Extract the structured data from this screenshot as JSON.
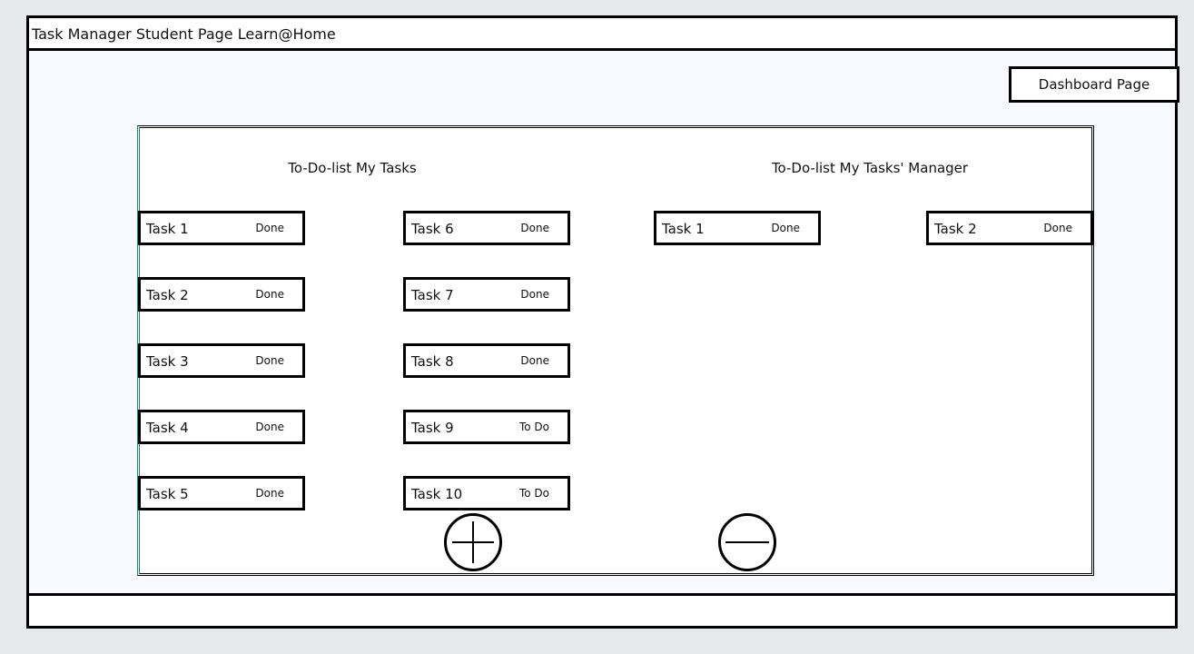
{
  "header": {
    "title": "Task Manager Student Page Learn@Home"
  },
  "dashboard_button": "Dashboard Page",
  "my_tasks": {
    "heading": "To-Do-list My Tasks",
    "tasks": [
      {
        "name": "Task 1",
        "status": "Done"
      },
      {
        "name": "Task 2",
        "status": "Done"
      },
      {
        "name": "Task 3",
        "status": "Done"
      },
      {
        "name": "Task 4",
        "status": "Done"
      },
      {
        "name": "Task 5",
        "status": "Done"
      },
      {
        "name": "Task 6",
        "status": "Done"
      },
      {
        "name": "Task 7",
        "status": "Done"
      },
      {
        "name": "Task 8",
        "status": "Done"
      },
      {
        "name": "Task 9",
        "status": "To Do"
      },
      {
        "name": "Task 10",
        "status": "To Do"
      }
    ]
  },
  "manager_tasks": {
    "heading": "To-Do-list My Tasks' Manager",
    "tasks": [
      {
        "name": "Task 1",
        "status": "Done"
      },
      {
        "name": "Task 2",
        "status": "Done"
      }
    ]
  },
  "actions": {
    "add_icon": "plus-circle-icon",
    "remove_icon": "minus-circle-icon"
  }
}
